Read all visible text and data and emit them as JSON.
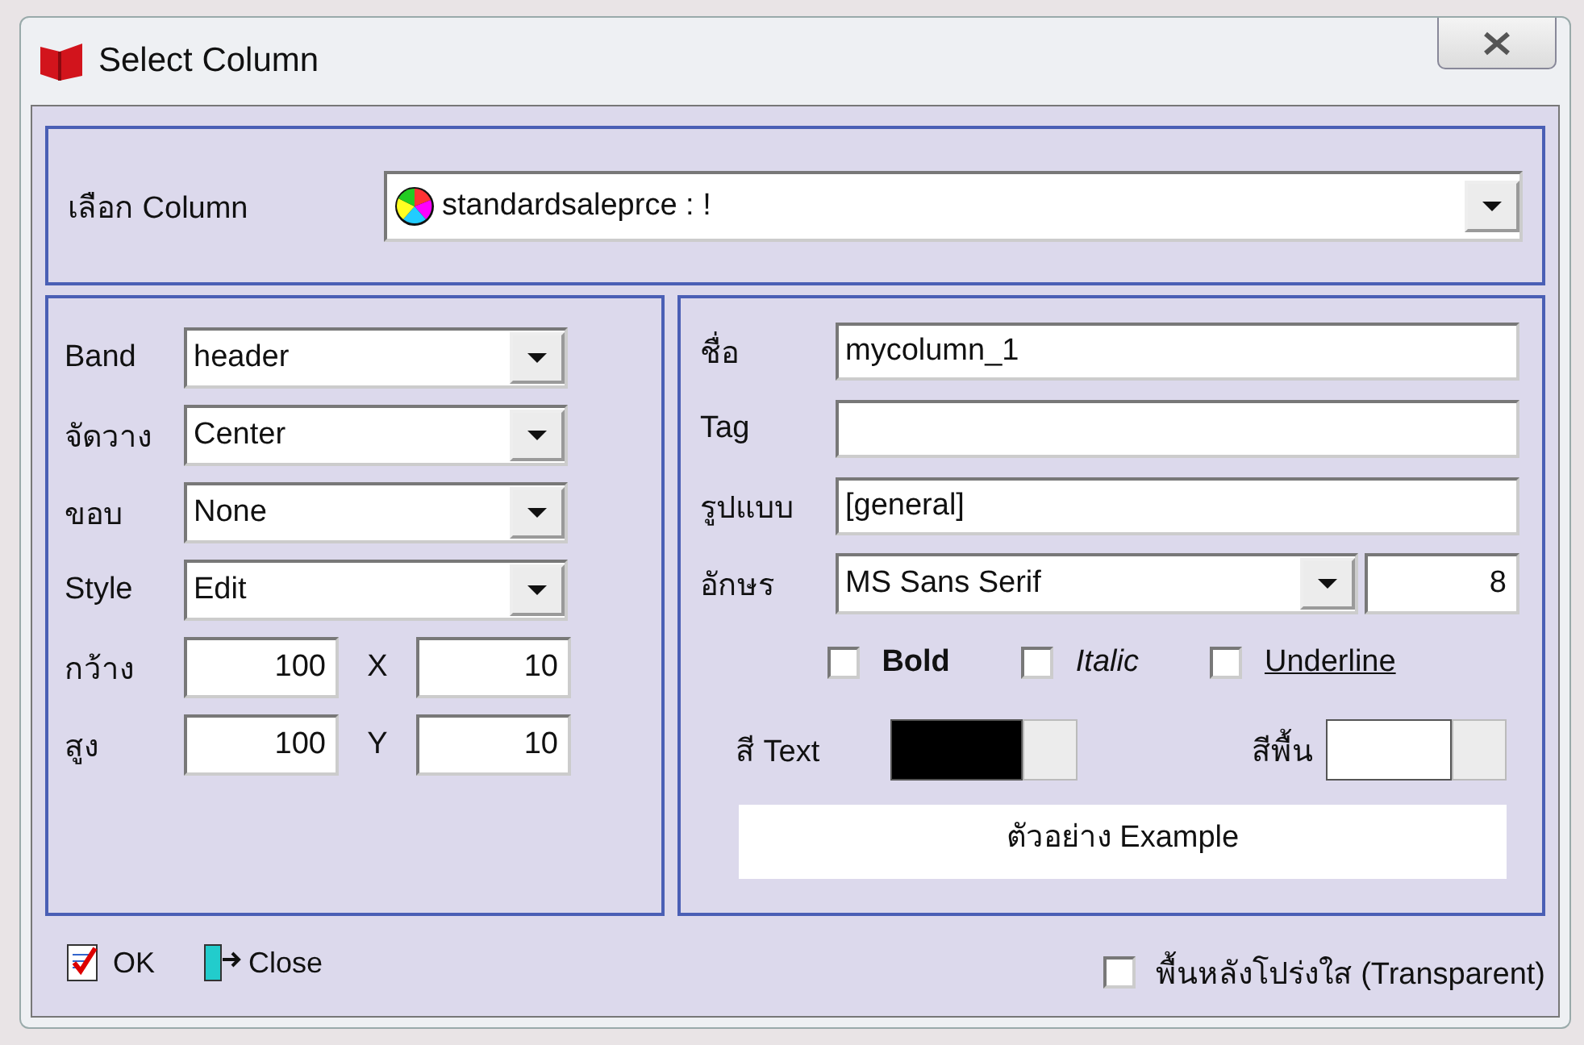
{
  "window": {
    "title": "Select Column"
  },
  "column_select": {
    "label": "เลือก Column",
    "value": "standardsaleprce : !"
  },
  "left_fields": [
    {
      "kind": "dropdown",
      "label": "Band",
      "value": "header"
    },
    {
      "kind": "dropdown",
      "label": "จัดวาง",
      "value": "Center"
    },
    {
      "kind": "dropdown",
      "label": "ขอบ",
      "value": "None"
    },
    {
      "kind": "dropdown",
      "label": "Style",
      "value": "Edit"
    },
    {
      "kind": "pair",
      "label": "กว้าง",
      "value": "100",
      "axis_label": "X",
      "axis_value": "10"
    },
    {
      "kind": "pair",
      "label": "สูง",
      "value": "100",
      "axis_label": "Y",
      "axis_value": "10"
    }
  ],
  "right_fields": [
    {
      "kind": "text",
      "label": "ชื่อ",
      "value": "mycolumn_1"
    },
    {
      "kind": "text",
      "label": "Tag"
    },
    {
      "kind": "text",
      "label": "รูปแบบ",
      "value": "[general]"
    },
    {
      "kind": "font",
      "label": "อักษร",
      "value": "MS Sans Serif",
      "size": "8"
    }
  ],
  "font_styles": [
    {
      "kind": "bold",
      "label": "Bold",
      "checked": false
    },
    {
      "kind": "italic",
      "label": "Italic",
      "checked": false
    },
    {
      "kind": "underline",
      "label": "Underline",
      "checked": false
    }
  ],
  "colors": [
    {
      "label": "สี Text",
      "color": "#000000"
    },
    {
      "label": "สีพื้น",
      "color": "#ffffff"
    }
  ],
  "preview": "ตัวอย่าง Example",
  "buttons": [
    {
      "kind": "ok",
      "label": "OK"
    },
    {
      "kind": "close",
      "label": "Close"
    }
  ],
  "transparent": {
    "label": "พื้นหลังโปร่งใส (Transparent)",
    "checked": false
  }
}
